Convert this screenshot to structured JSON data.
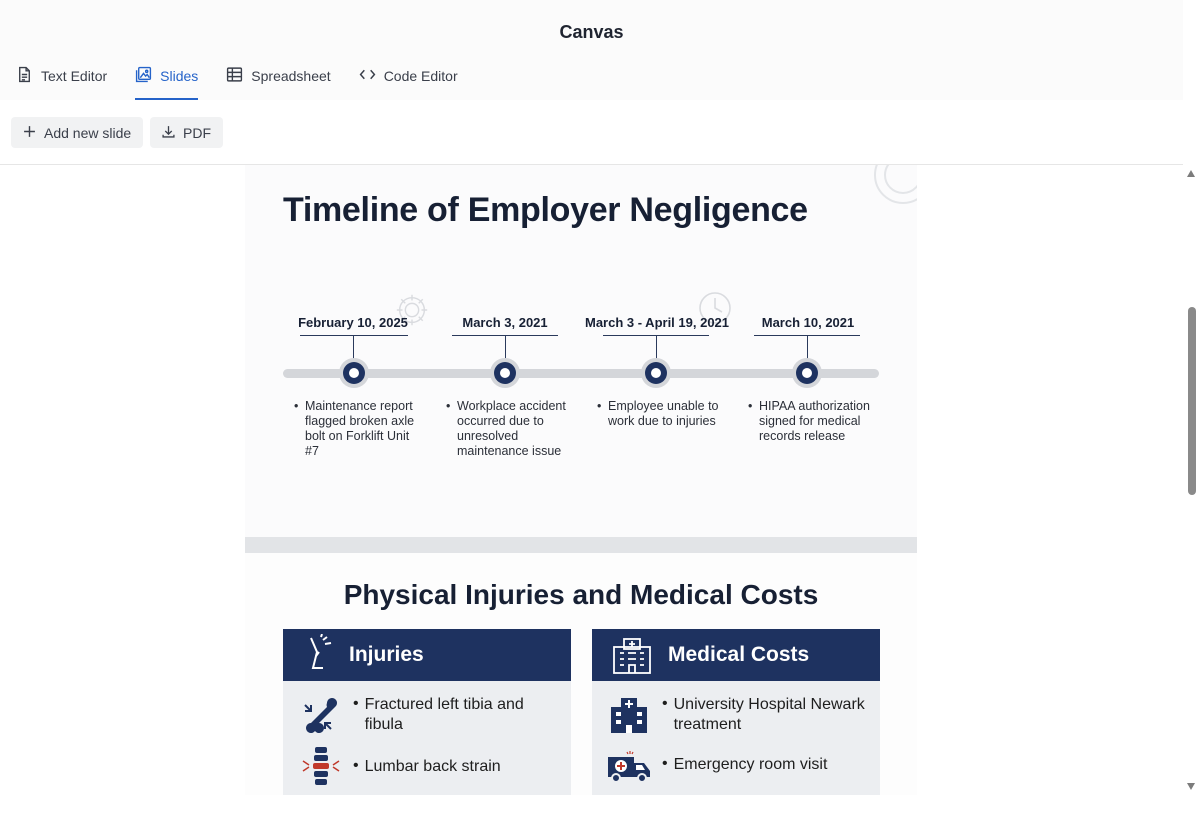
{
  "window": {
    "title": "Canvas"
  },
  "tabs": [
    {
      "label": "Text Editor",
      "icon": "document-icon"
    },
    {
      "label": "Slides",
      "icon": "slides-icon",
      "active": true
    },
    {
      "label": "Spreadsheet",
      "icon": "table-icon"
    },
    {
      "label": "Code Editor",
      "icon": "code-icon"
    }
  ],
  "toolbar": {
    "add_slide_label": "Add new slide",
    "pdf_label": "PDF"
  },
  "slide1": {
    "title": "Timeline of Employer Negligence",
    "events": [
      {
        "date": "February 10, 2025",
        "lines": [
          "Maintenance report",
          "flagged broken axle",
          "bolt on Forklift Unit",
          "#7"
        ]
      },
      {
        "date": "March 3, 2021",
        "lines": [
          "Workplace accident",
          "occurred due to",
          "unresolved",
          "maintenance issue"
        ]
      },
      {
        "date": "March 3 - April 19, 2021",
        "lines": [
          "Employee unable to",
          "work due to injuries"
        ]
      },
      {
        "date": "March 10, 2021",
        "lines": [
          "HIPAA authorization",
          "signed for medical",
          "records release"
        ]
      }
    ]
  },
  "slide2": {
    "title": "Physical Injuries and Medical Costs",
    "injuries": {
      "heading": "Injuries",
      "items": [
        {
          "icon": "bone-icon",
          "lines": [
            "Fractured left tibia and",
            "fibula"
          ]
        },
        {
          "icon": "spine-icon",
          "lines": [
            "Lumbar back strain"
          ]
        }
      ]
    },
    "costs": {
      "heading": "Medical Costs",
      "items": [
        {
          "icon": "hospital-icon",
          "lines": [
            "University Hospital Newark",
            "treatment"
          ]
        },
        {
          "icon": "ambulance-icon",
          "lines": [
            "Emergency room visit"
          ]
        }
      ]
    }
  },
  "colors": {
    "accent": "#2563c9",
    "navy": "#1e3260",
    "timeline_gray": "#d4d6da"
  }
}
